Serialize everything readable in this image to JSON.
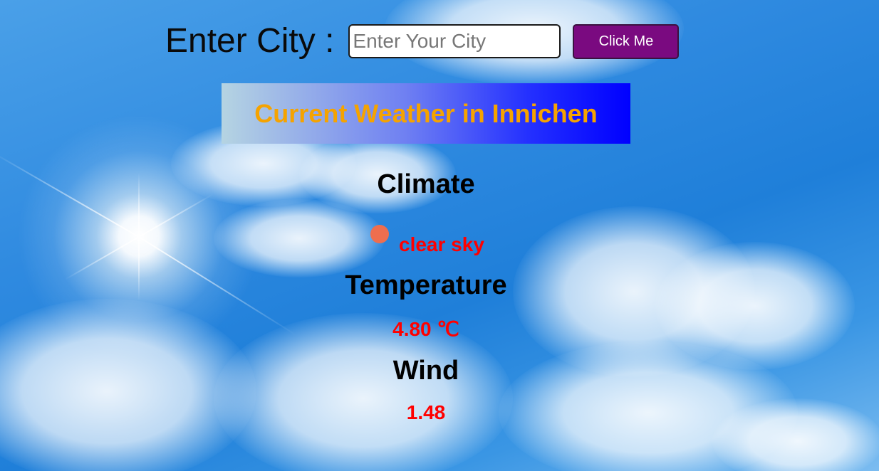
{
  "search": {
    "label": "Enter City :",
    "placeholder": "Enter Your City",
    "value": "",
    "button_label": "Click Me"
  },
  "weather": {
    "title": "Current Weather in Innichen",
    "climate_heading": "Climate",
    "climate_value": "clear sky",
    "climate_icon": "clear-sky-icon",
    "temperature_heading": "Temperature",
    "temperature_value": "4.80 ℃",
    "wind_heading": "Wind",
    "wind_value": "1.48"
  },
  "colors": {
    "button": "#7a0a80",
    "title_text": "#f5a300",
    "value_text": "#ff0000",
    "title_gradient_end": "#0000ff",
    "icon": "#ee6e4f"
  }
}
